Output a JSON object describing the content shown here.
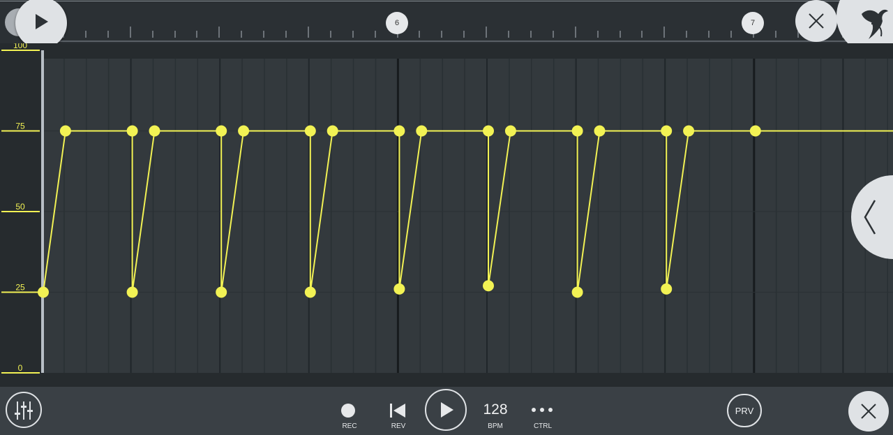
{
  "timeline": {
    "markers": [
      "6",
      "7"
    ]
  },
  "axis": {
    "labels": [
      "100",
      "75",
      "50",
      "25",
      "0"
    ]
  },
  "automation": {
    "color": "#f2f254",
    "points": [
      [
        0,
        25
      ],
      [
        1,
        75
      ],
      [
        4,
        75
      ],
      [
        4,
        25
      ],
      [
        5,
        75
      ],
      [
        8,
        75
      ],
      [
        8,
        25
      ],
      [
        9,
        75
      ],
      [
        12,
        75
      ],
      [
        12,
        25
      ],
      [
        13,
        75
      ],
      [
        16,
        75
      ],
      [
        16,
        26
      ],
      [
        17,
        75
      ],
      [
        20,
        75
      ],
      [
        20,
        27
      ],
      [
        21,
        75
      ],
      [
        24,
        75
      ],
      [
        24,
        25
      ],
      [
        25,
        75
      ],
      [
        28,
        75
      ],
      [
        28,
        26
      ],
      [
        29,
        75
      ],
      [
        32,
        75
      ]
    ]
  },
  "transport": {
    "rec_label": "REC",
    "rev_label": "REV",
    "bpm_value": "128",
    "bpm_label": "BPM",
    "ctrl_label": "CTRL",
    "prv_label": "PRV"
  },
  "icons": {
    "top_play": "play-icon",
    "top_close": "close-icon",
    "logo": "fl-studio-logo",
    "side_collapse": "chevron-left-icon",
    "mixer": "mixer-sliders-icon",
    "record": "record-icon",
    "rewind": "skip-back-icon",
    "play": "play-icon",
    "more": "more-dots-icon",
    "bottom_close": "close-icon"
  }
}
